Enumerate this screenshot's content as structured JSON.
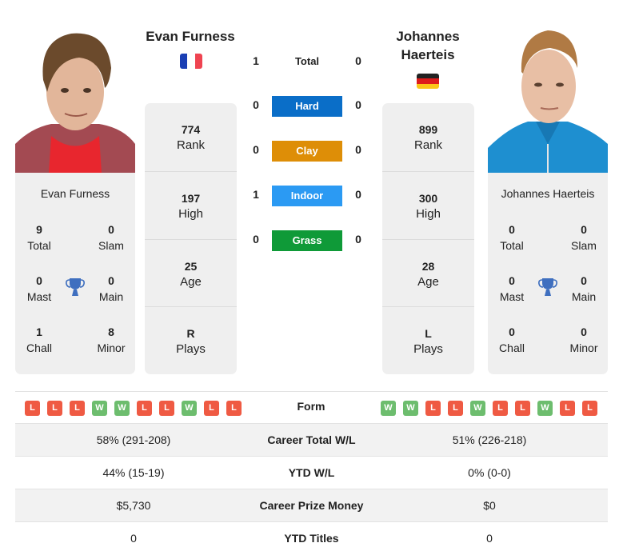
{
  "player1": {
    "name": "Evan Furness",
    "country_flag": "france-flag",
    "photo": "player-photo",
    "titles": {
      "total": {
        "value": "9",
        "label": "Total"
      },
      "slam": {
        "value": "0",
        "label": "Slam"
      },
      "mast": {
        "value": "0",
        "label": "Mast"
      },
      "main": {
        "value": "0",
        "label": "Main"
      },
      "chall": {
        "value": "1",
        "label": "Chall"
      },
      "minor": {
        "value": "8",
        "label": "Minor"
      }
    },
    "stats": {
      "rank": {
        "value": "774",
        "label": "Rank"
      },
      "high": {
        "value": "197",
        "label": "High"
      },
      "age": {
        "value": "25",
        "label": "Age"
      },
      "plays": {
        "value": "R",
        "label": "Plays"
      }
    },
    "form": [
      "L",
      "L",
      "L",
      "W",
      "W",
      "L",
      "L",
      "W",
      "L",
      "L"
    ]
  },
  "player2": {
    "name_line1": "Johannes",
    "name_line2": "Haerteis",
    "name": "Johannes Haerteis",
    "country_flag": "germany-flag",
    "photo": "player-photo",
    "titles": {
      "total": {
        "value": "0",
        "label": "Total"
      },
      "slam": {
        "value": "0",
        "label": "Slam"
      },
      "mast": {
        "value": "0",
        "label": "Mast"
      },
      "main": {
        "value": "0",
        "label": "Main"
      },
      "chall": {
        "value": "0",
        "label": "Chall"
      },
      "minor": {
        "value": "0",
        "label": "Minor"
      }
    },
    "stats": {
      "rank": {
        "value": "899",
        "label": "Rank"
      },
      "high": {
        "value": "300",
        "label": "High"
      },
      "age": {
        "value": "28",
        "label": "Age"
      },
      "plays": {
        "value": "L",
        "label": "Plays"
      }
    },
    "form": [
      "W",
      "W",
      "L",
      "L",
      "W",
      "L",
      "L",
      "W",
      "L",
      "L"
    ]
  },
  "h2h": [
    {
      "label": "Total",
      "p1": "1",
      "p2": "0",
      "color": null
    },
    {
      "label": "Hard",
      "p1": "0",
      "p2": "0",
      "color": "#0a6ec8"
    },
    {
      "label": "Clay",
      "p1": "0",
      "p2": "0",
      "color": "#de8e07"
    },
    {
      "label": "Indoor",
      "p1": "1",
      "p2": "0",
      "color": "#2b9af3"
    },
    {
      "label": "Grass",
      "p1": "0",
      "p2": "0",
      "color": "#0f9a38"
    }
  ],
  "form_label": "Form",
  "form_colors": {
    "W": "#6dbd6e",
    "L": "#ef5a43"
  },
  "comparison": [
    {
      "label": "Career Total W/L",
      "p1": "58% (291-208)",
      "p2": "51% (226-218)"
    },
    {
      "label": "YTD W/L",
      "p1": "44% (15-19)",
      "p2": "0% (0-0)"
    },
    {
      "label": "Career Prize Money",
      "p1": "$5,730",
      "p2": "$0"
    },
    {
      "label": "YTD Titles",
      "p1": "0",
      "p2": "0"
    }
  ]
}
